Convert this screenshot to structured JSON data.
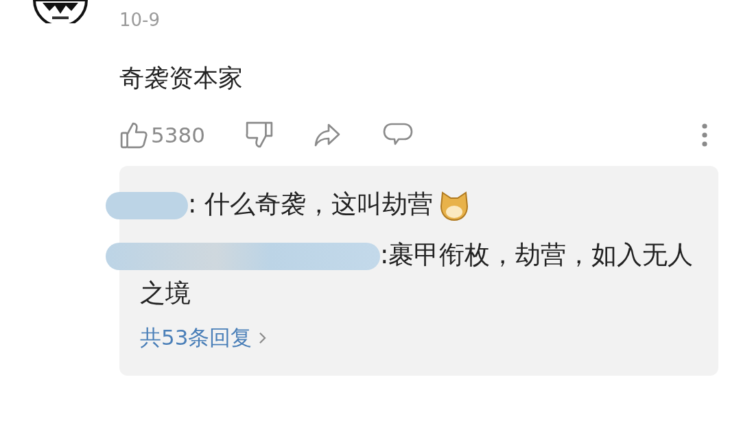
{
  "comment": {
    "date": "10-9",
    "text": "奇袭资本家",
    "like_count": "5380"
  },
  "replies": [
    {
      "text": ": 什么奇袭，这叫劫营",
      "redacted": true,
      "emoji": true
    },
    {
      "text": ":裹甲衔枚，劫营，如入无人之境",
      "redacted": true,
      "emoji": false
    }
  ],
  "more_replies": "共53条回复"
}
